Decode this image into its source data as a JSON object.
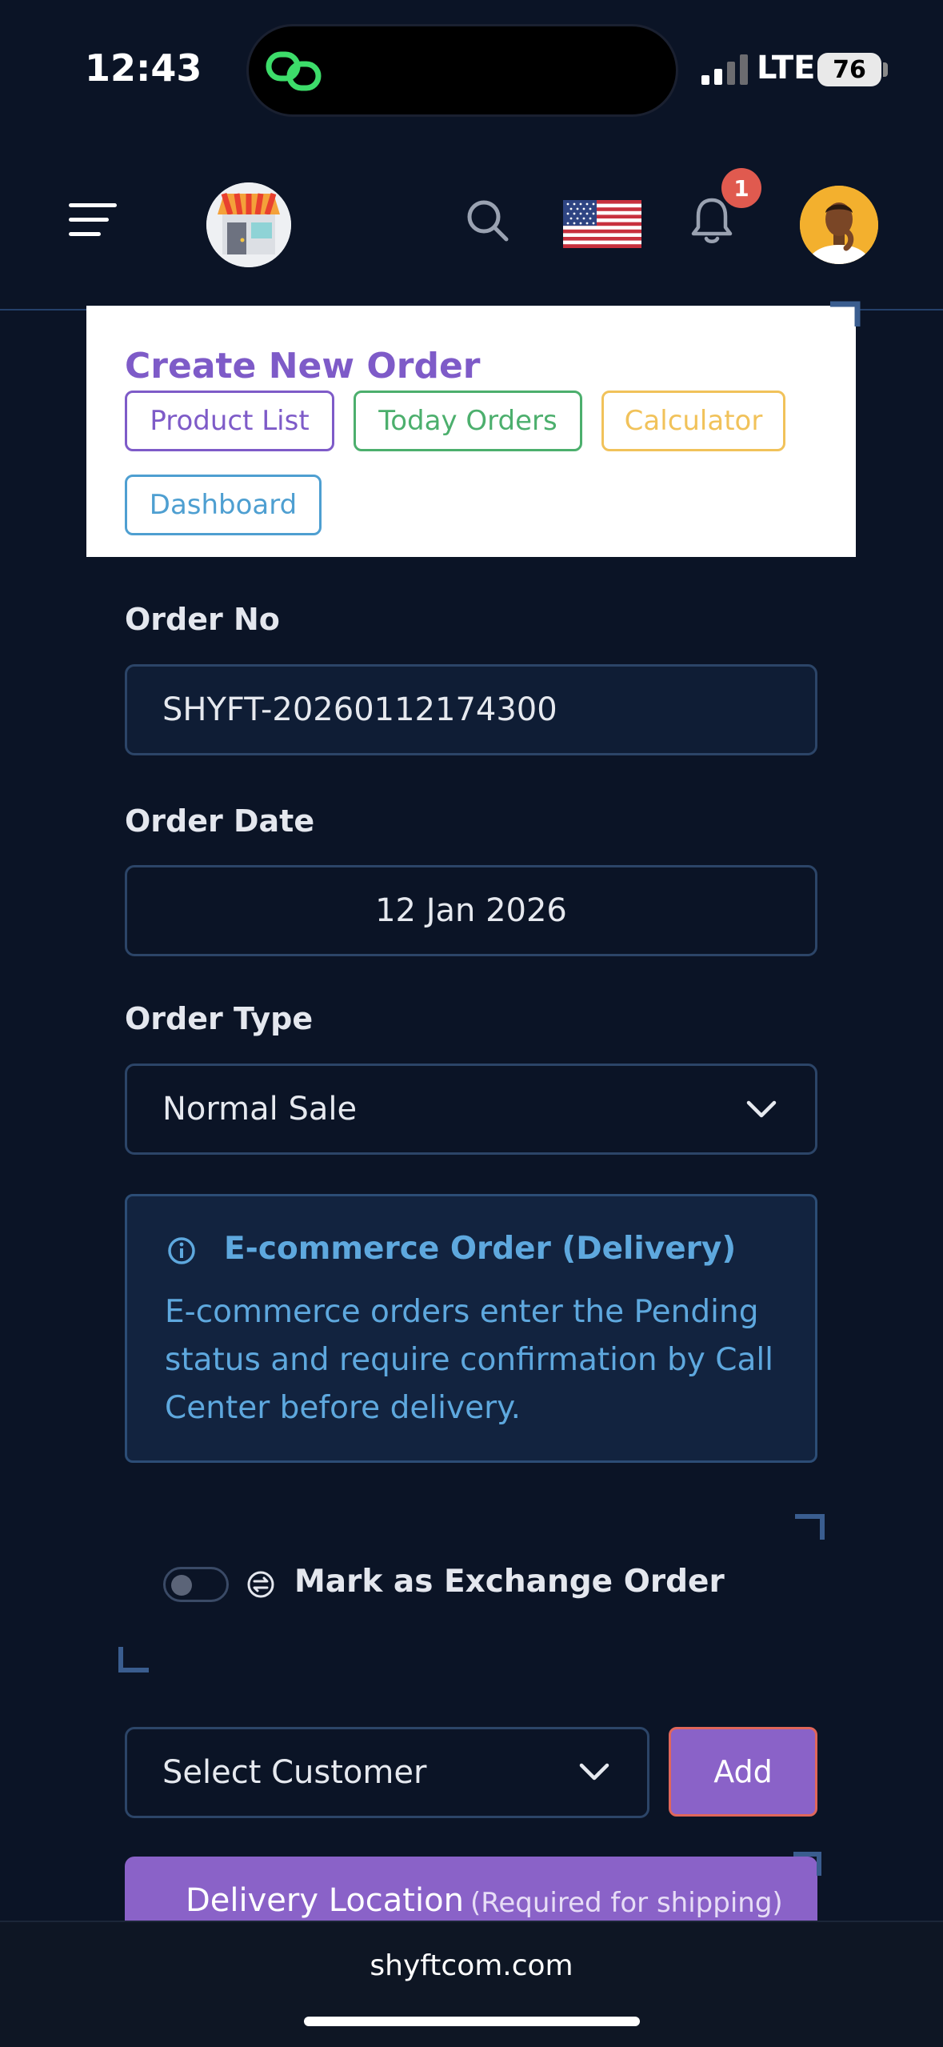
{
  "status_bar": {
    "time": "12:43",
    "network": "LTE",
    "battery": "76"
  },
  "header": {
    "menu_icon": "hamburger-menu-icon",
    "logo_icon": "store-icon",
    "search_icon": "search-icon",
    "language_icon": "us-flag-icon",
    "notifications_icon": "bell-icon",
    "notification_count": "1",
    "avatar_icon": "user-avatar"
  },
  "card": {
    "title": "Create New Order",
    "buttons": {
      "product_list": "Product List",
      "today_orders": "Today Orders",
      "calculator": "Calculator",
      "dashboard": "Dashboard"
    }
  },
  "form": {
    "order_no": {
      "label": "Order No",
      "value": "SHYFT-20260112174300"
    },
    "order_date": {
      "label": "Order Date",
      "value": "12 Jan 2026"
    },
    "order_type": {
      "label": "Order Type",
      "value": "Normal Sale"
    },
    "info": {
      "title": "E-commerce Order (Delivery)",
      "text": "E-commerce orders enter the Pending status and require confirmation by Call Center before delivery."
    },
    "exchange": {
      "label": "Mark as Exchange Order",
      "checked": false
    },
    "customer": {
      "placeholder": "Select Customer",
      "add_label": "Add"
    },
    "delivery": {
      "title": "Delivery Location",
      "subtitle": "(Required for shipping)"
    }
  },
  "browser": {
    "url": "shyftcom.com"
  },
  "colors": {
    "background": "#0b1426",
    "accent_purple": "#8a62c8",
    "title_purple": "#7e5bc8",
    "green": "#4caf6d",
    "yellow": "#f1c25a",
    "blue": "#4e9fd1",
    "info_blue": "#5ea8de",
    "badge_red": "#e05a4f"
  }
}
